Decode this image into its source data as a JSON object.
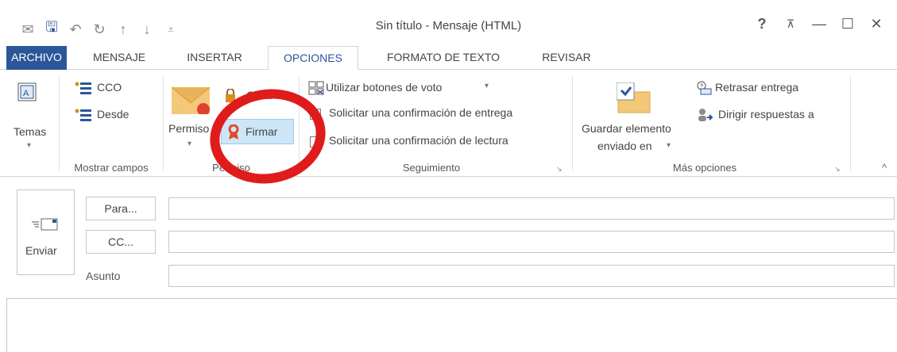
{
  "window": {
    "title": "Sin título - Mensaje (HTML)",
    "help": "?",
    "ribbon_display": "⊼",
    "minimize": "—",
    "maximize": "☐",
    "close": "✕"
  },
  "qat": {
    "mail": "✉",
    "save": "🖫",
    "undo": "↶",
    "redo": "↻",
    "up": "↑",
    "down": "↓",
    "customize": "⩡"
  },
  "tabs": [
    "ARCHIVO",
    "MENSAJE",
    "INSERTAR",
    "OPCIONES",
    "FORMATO DE TEXTO",
    "REVISAR"
  ],
  "ribbon": {
    "temas": {
      "label": "Temas",
      "arrow": "▾"
    },
    "show_fields": {
      "cco": "CCO",
      "desde": "Desde",
      "group": "Mostrar campos"
    },
    "permiso": {
      "label": "Permiso",
      "arrow": "▾",
      "cifrar": "Cifrar",
      "firmar": "Firmar",
      "group": "Permiso"
    },
    "seguimiento": {
      "voting": "Utilizar botones de voto",
      "voting_arrow": "▾",
      "delivery": "Solicitar una confirmación de entrega",
      "read": "Solicitar una confirmación de lectura",
      "group": "Seguimiento"
    },
    "mas_opciones": {
      "save_sent_line1": "Guardar elemento",
      "save_sent_line2": "enviado en",
      "save_sent_arrow": "▾",
      "delay": "Retrasar entrega",
      "direct_replies": "Dirigir respuestas a",
      "group": "Más opciones"
    },
    "collapse": "^",
    "launcher": "↘"
  },
  "compose": {
    "send": "Enviar",
    "to": "Para...",
    "cc": "CC...",
    "subject": "Asunto"
  },
  "colors": {
    "accent": "#2b579a",
    "highlight": "#cde6f7",
    "annotation": "#e01b1b"
  }
}
